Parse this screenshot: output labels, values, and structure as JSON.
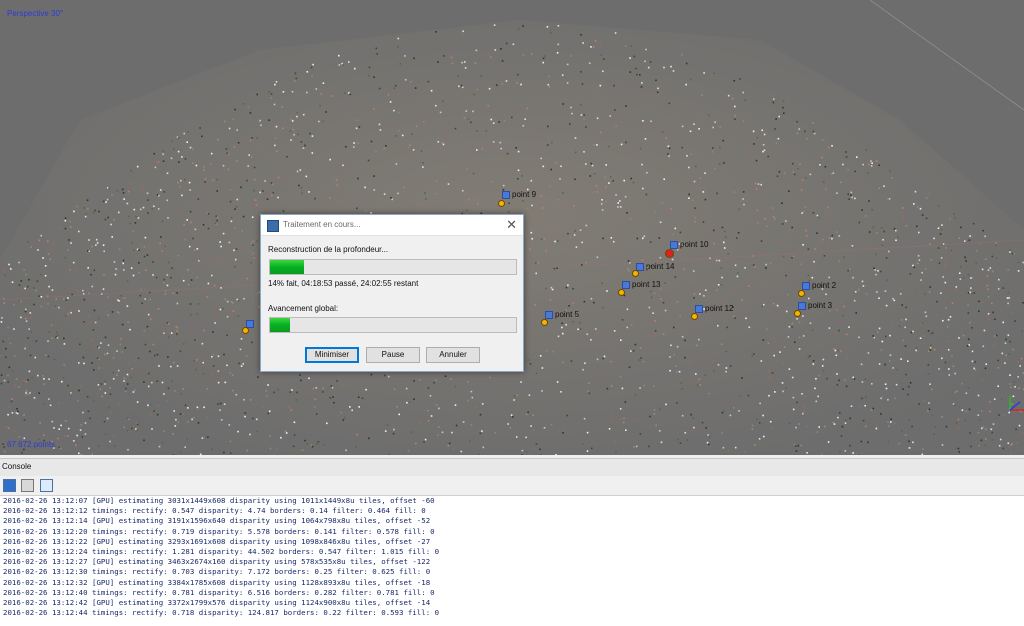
{
  "viewport": {
    "perspective_label": "Perspective 30°",
    "point_count": "67 672 points",
    "markers": [
      {
        "id": "m9",
        "label": "point 9",
        "kind": "normal"
      },
      {
        "id": "m10",
        "label": "point 10",
        "kind": "selected"
      },
      {
        "id": "m14",
        "label": "point 14",
        "kind": "normal"
      },
      {
        "id": "m13",
        "label": "point 13",
        "kind": "normal"
      },
      {
        "id": "m2",
        "label": "point 2",
        "kind": "normal"
      },
      {
        "id": "m5",
        "label": "point 5",
        "kind": "normal"
      },
      {
        "id": "m12",
        "label": "point 12",
        "kind": "normal"
      },
      {
        "id": "m3",
        "label": "point 3",
        "kind": "normal"
      },
      {
        "id": "mL",
        "label": "",
        "kind": "normal"
      }
    ]
  },
  "dialog": {
    "title": "Traitement en cours...",
    "stage_label": "Reconstruction de la profondeur...",
    "stage_progress": 0.14,
    "stage_status": "14% fait, 04:18:53 passé, 24:02:55 restant",
    "global_label": "Avancement global:",
    "global_progress": 0.08,
    "buttons": {
      "minimize": "Minimiser",
      "pause": "Pause",
      "cancel": "Annuler"
    }
  },
  "console": {
    "title": "Console",
    "toolbar_icons": [
      "save-icon",
      "copy-icon",
      "clear-icon"
    ],
    "lines": [
      "2016-02-26 13:12:07 [GPU] estimating 3031x1449x608 disparity using 1011x1449x8u tiles, offset -60",
      "2016-02-26 13:12:12 timings: rectify: 0.547 disparity: 4.74 borders: 0.14 filter: 0.464 fill: 0",
      "2016-02-26 13:12:14 [GPU] estimating 3191x1596x640 disparity using 1064x798x8u tiles, offset -52",
      "2016-02-26 13:12:20 timings: rectify: 0.719 disparity: 5.578 borders: 0.141 filter: 0.578 fill: 0",
      "2016-02-26 13:12:22 [GPU] estimating 3293x1691x608 disparity using 1098x846x8u tiles, offset -27",
      "2016-02-26 13:12:24 timings: rectify: 1.281 disparity: 44.502 borders: 0.547 filter: 1.015 fill: 0",
      "2016-02-26 13:12:27 [GPU] estimating 3463x2674x160 disparity using 578x535x8u tiles, offset -122",
      "2016-02-26 13:12:30 timings: rectify: 0.703 disparity: 7.172 borders: 0.25 filter: 0.625 fill: 0",
      "2016-02-26 13:12:32 [GPU] estimating 3384x1785x608 disparity using 1128x893x8u tiles, offset -18",
      "2016-02-26 13:12:40 timings: rectify: 0.781 disparity: 6.516 borders: 0.282 filter: 0.781 fill: 0",
      "2016-02-26 13:12:42 [GPU] estimating 3372x1799x576 disparity using 1124x900x8u tiles, offset -14",
      "2016-02-26 13:12:44 timings: rectify: 0.718 disparity: 124.817 borders: 0.22 filter: 0.593 fill: 0"
    ]
  }
}
